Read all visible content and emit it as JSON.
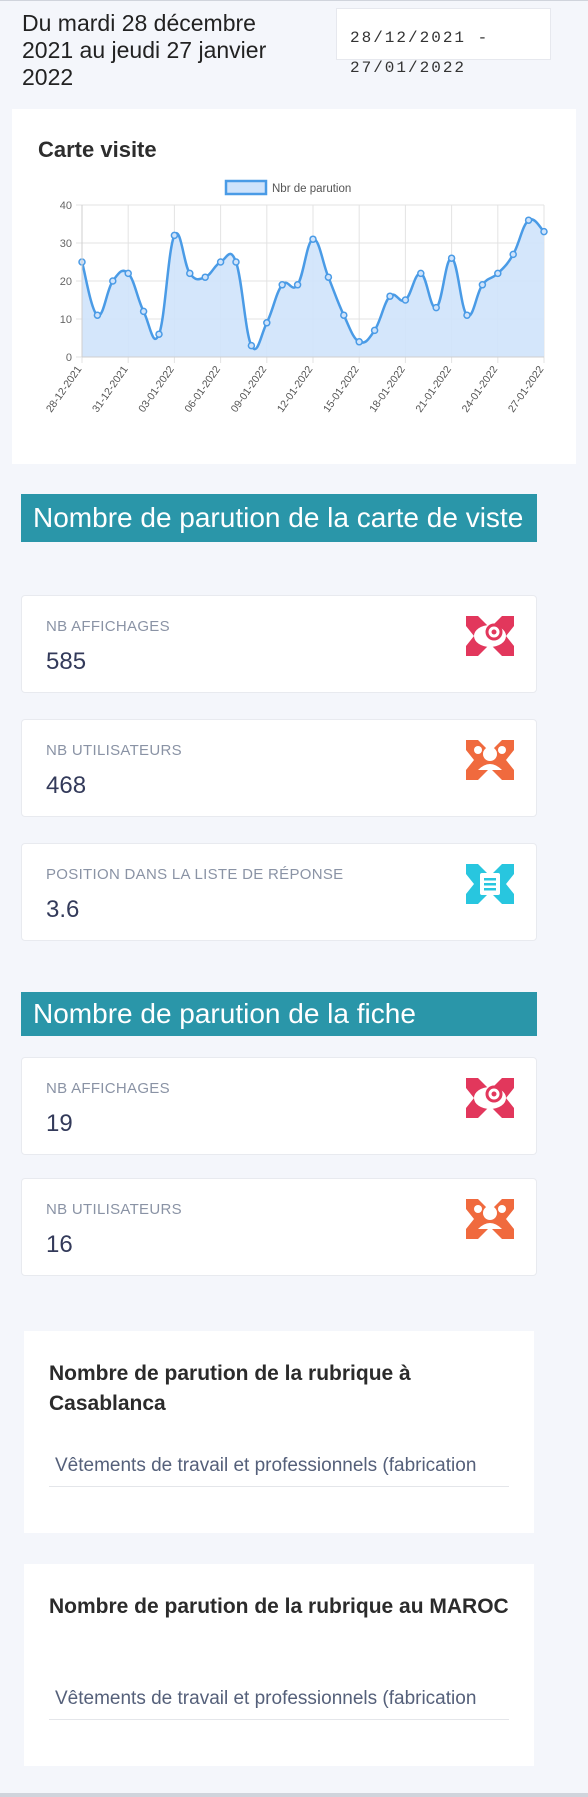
{
  "header": {
    "title": "Du mardi 28 décembre 2021 au jeudi 27 janvier 2022",
    "date_range_line1": "28/12/2021 -",
    "date_range_line2": "27/01/2022"
  },
  "chart_card": {
    "title": "Carte visite"
  },
  "chart_data": {
    "type": "area",
    "legend": "top",
    "grid": true,
    "ylim": [
      0,
      40
    ],
    "yticks": [
      0,
      10,
      20,
      30,
      40
    ],
    "x_tick_labels": [
      "28-12-2021",
      "31-12-2021",
      "03-01-2022",
      "06-01-2022",
      "09-01-2022",
      "12-01-2022",
      "15-01-2022",
      "18-01-2022",
      "21-01-2022",
      "24-01-2022",
      "27-01-2022"
    ],
    "series": [
      {
        "name": "Nbr de parution",
        "color": "#4a9be6",
        "fill": "#cfe3fb",
        "values": [
          25,
          11,
          20,
          22,
          12,
          6,
          32,
          22,
          21,
          25,
          25,
          3,
          9,
          19,
          19,
          31,
          21,
          11,
          4,
          7,
          16,
          15,
          22,
          13,
          26,
          11,
          19,
          22,
          27,
          36,
          33
        ]
      }
    ]
  },
  "card_section": {
    "title": "Nombre de parution de la carte de viste",
    "stats": [
      {
        "label": "NB AFFICHAGES",
        "value": "585",
        "icon": "eye-icon",
        "color": "#e2375c"
      },
      {
        "label": "NB UTILISATEURS",
        "value": "468",
        "icon": "users-icon",
        "color": "#f06a3e"
      },
      {
        "label": "POSITION DANS LA LISTE DE RÉPONSE",
        "value": "3.6",
        "icon": "list-icon",
        "color": "#28c6df"
      }
    ]
  },
  "fiche_section": {
    "title": "Nombre de parution de la fiche",
    "stats": [
      {
        "label": "NB AFFICHAGES",
        "value": "19",
        "icon": "eye-icon",
        "color": "#e2375c"
      },
      {
        "label": "NB UTILISATEURS",
        "value": "16",
        "icon": "users-icon",
        "color": "#f06a3e"
      }
    ]
  },
  "rubrique_casablanca": {
    "title": "Nombre de parution de la rubrique à Casablanca",
    "selected": "Vêtements de travail et professionnels (fabrication"
  },
  "rubrique_maroc": {
    "title": "Nombre de parution de la rubrique au MAROC",
    "selected": "Vêtements de travail et professionnels (fabrication"
  }
}
